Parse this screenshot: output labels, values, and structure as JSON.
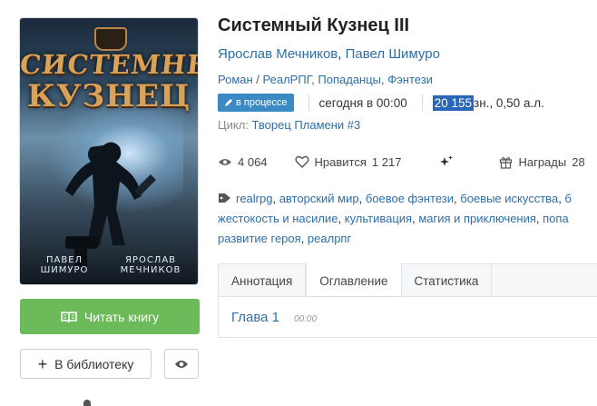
{
  "cover": {
    "title_line1": "СИСТЕМНЫЙ",
    "title_line2": "КУЗНЕЦ",
    "author1": "ПАВЕЛ ШИМУРО",
    "author2": "ЯРОСЛАВ МЕЧНИКОВ"
  },
  "buttons": {
    "read_label": "Читать книгу",
    "library_label": "В библиотеку"
  },
  "book": {
    "title": "Системный Кузнец III",
    "author1": "Ярослав Мечников",
    "author_sep": ", ",
    "author2": "Павел Шимуро",
    "genre1": "Роман",
    "genre_sep": " / ",
    "genre2": "РеалРПГ",
    "genre3": "Попаданцы",
    "genre4": "Фэнтези",
    "status": "в процессе",
    "updated": "сегодня в 00:00",
    "size_highlighted": "20 155",
    "size_rest": " зн., 0,50 а.л.",
    "cycle_label": "Цикл: ",
    "cycle_link": "Творец Пламени #3"
  },
  "stats": {
    "views": "4 064",
    "likes_label": "Нравится",
    "likes": "1 217",
    "awards_label": "Награды",
    "awards": "28"
  },
  "tags": {
    "row1": [
      "realrpg",
      "авторский мир",
      "боевое фэнтези",
      "боевые искусства",
      "б"
    ],
    "row2": [
      "жестокость и насилие",
      "культивация",
      "магия и приключения",
      "попа"
    ],
    "row3": [
      "развитие героя",
      "реалрпг"
    ]
  },
  "tabs": [
    "Аннотация",
    "Оглавление",
    "Статистика"
  ],
  "chapter": {
    "title": "Глава 1",
    "time": "00:00"
  },
  "colors": {
    "link": "#2f6fa8",
    "read_button": "#6dba5a",
    "status_badge": "#3c8ac4",
    "selection": "#2a66b8"
  }
}
